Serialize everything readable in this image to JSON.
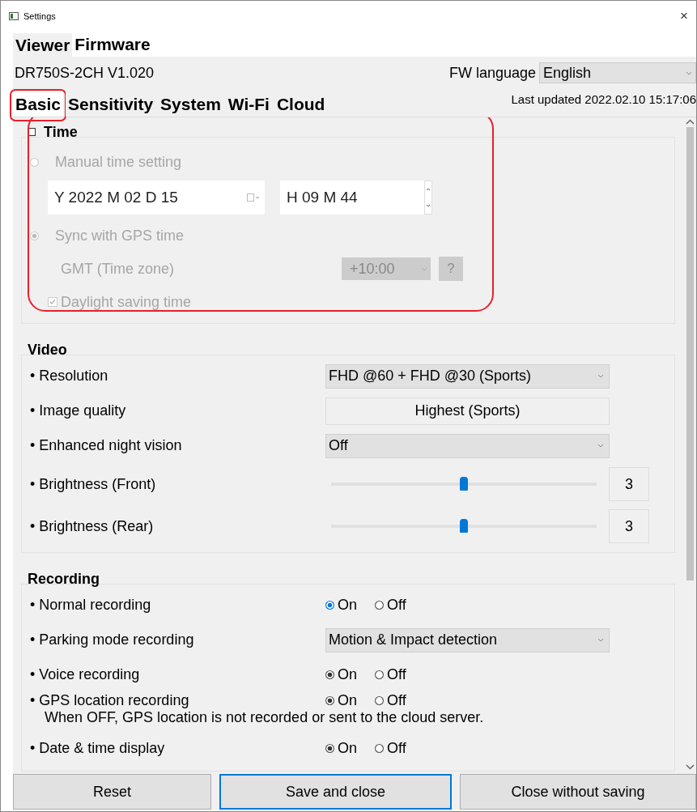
{
  "window": {
    "title": "Settings",
    "close": "×"
  },
  "top_tabs": [
    {
      "label": "Viewer",
      "selected": false
    },
    {
      "label": "Firmware",
      "selected": true
    }
  ],
  "model": "DR750S-2CH  V1.020",
  "fw_language": {
    "label": "FW language",
    "value": "English"
  },
  "tabs": [
    {
      "label": "Basic",
      "selected": true,
      "highlighted": true
    },
    {
      "label": "Sensitivity",
      "selected": false,
      "highlighted": false
    },
    {
      "label": "System",
      "selected": false,
      "highlighted": false
    },
    {
      "label": "Wi-Fi",
      "selected": false,
      "highlighted": false
    },
    {
      "label": "Cloud",
      "selected": false,
      "highlighted": false
    }
  ],
  "last_updated": "Last updated 2022.02.10 15:17:06",
  "time": {
    "title": "Time",
    "checked": false,
    "disabled": true,
    "highlighted": true,
    "manual": {
      "label": "Manual time setting",
      "selected": false
    },
    "date": "Y 2022 M 02 D 15",
    "time": "H 09 M 44",
    "gps": {
      "label": "Sync with GPS time",
      "selected": true
    },
    "gmt": {
      "label": "GMT (Time zone)",
      "value": "+10:00",
      "help": "?"
    },
    "dst": {
      "label": "Daylight saving time",
      "checked": true
    }
  },
  "sections": [
    {
      "title": "Video",
      "rows": [
        {
          "kind": "select",
          "label": "• Resolution",
          "value": "FHD @60 + FHD @30 (Sports)"
        },
        {
          "kind": "readonly",
          "label": "• Image quality",
          "value": "Highest (Sports)"
        },
        {
          "kind": "select",
          "label": "• Enhanced night vision",
          "value": "Off"
        },
        {
          "kind": "slider",
          "label": "• Brightness (Front)",
          "level": 0.5,
          "reading": "3"
        },
        {
          "kind": "slider",
          "label": "• Brightness (Rear)",
          "level": 0.5,
          "reading": "3"
        }
      ]
    },
    {
      "title": "Recording",
      "rows": [
        {
          "kind": "radio",
          "label": "• Normal recording",
          "options": [
            {
              "label": "On",
              "selected": true,
              "focused": true
            },
            {
              "label": "Off",
              "selected": false,
              "focused": false
            }
          ]
        },
        {
          "kind": "select",
          "label": "• Parking mode recording",
          "value": "Motion & Impact detection"
        },
        {
          "kind": "radio",
          "label": "• Voice recording",
          "options": [
            {
              "label": "On",
              "selected": true,
              "focused": false
            },
            {
              "label": "Off",
              "selected": false,
              "focused": false
            }
          ]
        },
        {
          "kind": "radio",
          "label": "• GPS location recording",
          "note": "When OFF, GPS location is not recorded or sent to the cloud server.",
          "options": [
            {
              "label": "On",
              "selected": true,
              "focused": false
            },
            {
              "label": "Off",
              "selected": false,
              "focused": false
            }
          ]
        },
        {
          "kind": "radio",
          "label": "• Date & time display",
          "options": [
            {
              "label": "On",
              "selected": true,
              "focused": false
            },
            {
              "label": "Off",
              "selected": false,
              "focused": false
            }
          ]
        }
      ]
    }
  ],
  "buttons": [
    {
      "label": "Reset",
      "default": false
    },
    {
      "label": "Save and close",
      "default": true
    },
    {
      "label": "Close without saving",
      "default": false
    }
  ]
}
